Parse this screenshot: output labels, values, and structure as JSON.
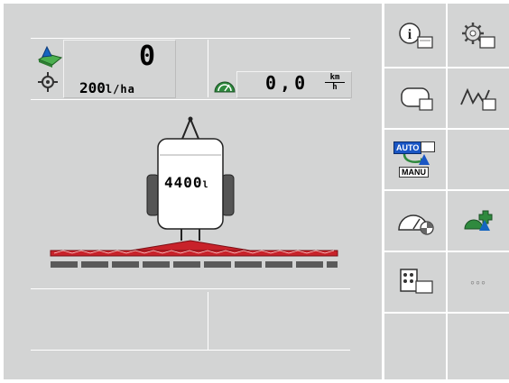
{
  "work_info": {
    "area_counter": "0",
    "application_rate_value": "200",
    "application_rate_unit": "l/ha"
  },
  "speed": {
    "value": "0,0",
    "unit_top": "km",
    "unit_bottom": "h"
  },
  "tank": {
    "volume_value": "4400",
    "volume_unit": "l"
  },
  "side_menu": {
    "auto_label": "AUTO",
    "manu_label": "MANU",
    "more_label": "◦◦◦"
  },
  "colors": {
    "background": "#d3d4d4",
    "boom_red": "#c8222a",
    "section_gray": "#5a5a5a",
    "speed_green": "#2f8a3e",
    "auto_blue": "#1a56c4",
    "field_blue": "#1565c0",
    "field_green": "#4caf50"
  },
  "icons": [
    "info-icon",
    "settings-icon",
    "tank-icon",
    "boom-fold-icon",
    "auto-manual-icon",
    "speedometer-icon",
    "gps-target-icon",
    "keypad-icon",
    "more-icon",
    "area-field-icon",
    "target-icon",
    "speedometer-small-icon"
  ]
}
